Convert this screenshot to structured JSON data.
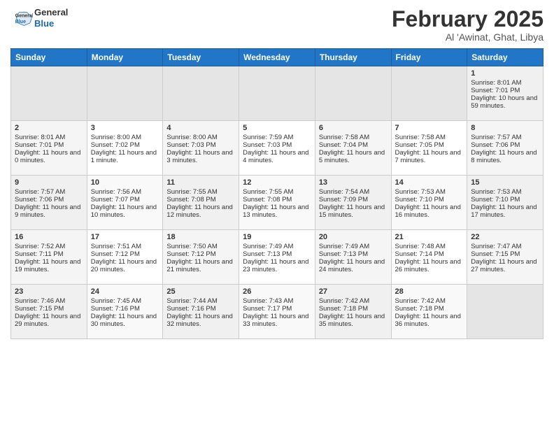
{
  "logo": {
    "general": "General",
    "blue": "Blue"
  },
  "title": "February 2025",
  "subtitle": "Al 'Awinat, Ghat, Libya",
  "headers": [
    "Sunday",
    "Monday",
    "Tuesday",
    "Wednesday",
    "Thursday",
    "Friday",
    "Saturday"
  ],
  "weeks": [
    [
      {
        "day": "",
        "empty": true
      },
      {
        "day": "",
        "empty": true
      },
      {
        "day": "",
        "empty": true
      },
      {
        "day": "",
        "empty": true
      },
      {
        "day": "",
        "empty": true
      },
      {
        "day": "",
        "empty": true
      },
      {
        "day": "1",
        "sunrise": "Sunrise: 8:01 AM",
        "sunset": "Sunset: 7:01 PM",
        "daylight": "Daylight: 10 hours and 59 minutes."
      }
    ],
    [
      {
        "day": "2",
        "sunrise": "Sunrise: 8:01 AM",
        "sunset": "Sunset: 7:01 PM",
        "daylight": "Daylight: 11 hours and 0 minutes."
      },
      {
        "day": "3",
        "sunrise": "Sunrise: 8:00 AM",
        "sunset": "Sunset: 7:02 PM",
        "daylight": "Daylight: 11 hours and 1 minute."
      },
      {
        "day": "4",
        "sunrise": "Sunrise: 8:00 AM",
        "sunset": "Sunset: 7:03 PM",
        "daylight": "Daylight: 11 hours and 3 minutes."
      },
      {
        "day": "5",
        "sunrise": "Sunrise: 7:59 AM",
        "sunset": "Sunset: 7:03 PM",
        "daylight": "Daylight: 11 hours and 4 minutes."
      },
      {
        "day": "6",
        "sunrise": "Sunrise: 7:58 AM",
        "sunset": "Sunset: 7:04 PM",
        "daylight": "Daylight: 11 hours and 5 minutes."
      },
      {
        "day": "7",
        "sunrise": "Sunrise: 7:58 AM",
        "sunset": "Sunset: 7:05 PM",
        "daylight": "Daylight: 11 hours and 7 minutes."
      },
      {
        "day": "8",
        "sunrise": "Sunrise: 7:57 AM",
        "sunset": "Sunset: 7:06 PM",
        "daylight": "Daylight: 11 hours and 8 minutes."
      }
    ],
    [
      {
        "day": "9",
        "sunrise": "Sunrise: 7:57 AM",
        "sunset": "Sunset: 7:06 PM",
        "daylight": "Daylight: 11 hours and 9 minutes."
      },
      {
        "day": "10",
        "sunrise": "Sunrise: 7:56 AM",
        "sunset": "Sunset: 7:07 PM",
        "daylight": "Daylight: 11 hours and 10 minutes."
      },
      {
        "day": "11",
        "sunrise": "Sunrise: 7:55 AM",
        "sunset": "Sunset: 7:08 PM",
        "daylight": "Daylight: 11 hours and 12 minutes."
      },
      {
        "day": "12",
        "sunrise": "Sunrise: 7:55 AM",
        "sunset": "Sunset: 7:08 PM",
        "daylight": "Daylight: 11 hours and 13 minutes."
      },
      {
        "day": "13",
        "sunrise": "Sunrise: 7:54 AM",
        "sunset": "Sunset: 7:09 PM",
        "daylight": "Daylight: 11 hours and 15 minutes."
      },
      {
        "day": "14",
        "sunrise": "Sunrise: 7:53 AM",
        "sunset": "Sunset: 7:10 PM",
        "daylight": "Daylight: 11 hours and 16 minutes."
      },
      {
        "day": "15",
        "sunrise": "Sunrise: 7:53 AM",
        "sunset": "Sunset: 7:10 PM",
        "daylight": "Daylight: 11 hours and 17 minutes."
      }
    ],
    [
      {
        "day": "16",
        "sunrise": "Sunrise: 7:52 AM",
        "sunset": "Sunset: 7:11 PM",
        "daylight": "Daylight: 11 hours and 19 minutes."
      },
      {
        "day": "17",
        "sunrise": "Sunrise: 7:51 AM",
        "sunset": "Sunset: 7:12 PM",
        "daylight": "Daylight: 11 hours and 20 minutes."
      },
      {
        "day": "18",
        "sunrise": "Sunrise: 7:50 AM",
        "sunset": "Sunset: 7:12 PM",
        "daylight": "Daylight: 11 hours and 21 minutes."
      },
      {
        "day": "19",
        "sunrise": "Sunrise: 7:49 AM",
        "sunset": "Sunset: 7:13 PM",
        "daylight": "Daylight: 11 hours and 23 minutes."
      },
      {
        "day": "20",
        "sunrise": "Sunrise: 7:49 AM",
        "sunset": "Sunset: 7:13 PM",
        "daylight": "Daylight: 11 hours and 24 minutes."
      },
      {
        "day": "21",
        "sunrise": "Sunrise: 7:48 AM",
        "sunset": "Sunset: 7:14 PM",
        "daylight": "Daylight: 11 hours and 26 minutes."
      },
      {
        "day": "22",
        "sunrise": "Sunrise: 7:47 AM",
        "sunset": "Sunset: 7:15 PM",
        "daylight": "Daylight: 11 hours and 27 minutes."
      }
    ],
    [
      {
        "day": "23",
        "sunrise": "Sunrise: 7:46 AM",
        "sunset": "Sunset: 7:15 PM",
        "daylight": "Daylight: 11 hours and 29 minutes."
      },
      {
        "day": "24",
        "sunrise": "Sunrise: 7:45 AM",
        "sunset": "Sunset: 7:16 PM",
        "daylight": "Daylight: 11 hours and 30 minutes."
      },
      {
        "day": "25",
        "sunrise": "Sunrise: 7:44 AM",
        "sunset": "Sunset: 7:16 PM",
        "daylight": "Daylight: 11 hours and 32 minutes."
      },
      {
        "day": "26",
        "sunrise": "Sunrise: 7:43 AM",
        "sunset": "Sunset: 7:17 PM",
        "daylight": "Daylight: 11 hours and 33 minutes."
      },
      {
        "day": "27",
        "sunrise": "Sunrise: 7:42 AM",
        "sunset": "Sunset: 7:18 PM",
        "daylight": "Daylight: 11 hours and 35 minutes."
      },
      {
        "day": "28",
        "sunrise": "Sunrise: 7:42 AM",
        "sunset": "Sunset: 7:18 PM",
        "daylight": "Daylight: 11 hours and 36 minutes."
      },
      {
        "day": "",
        "empty": true
      }
    ]
  ]
}
